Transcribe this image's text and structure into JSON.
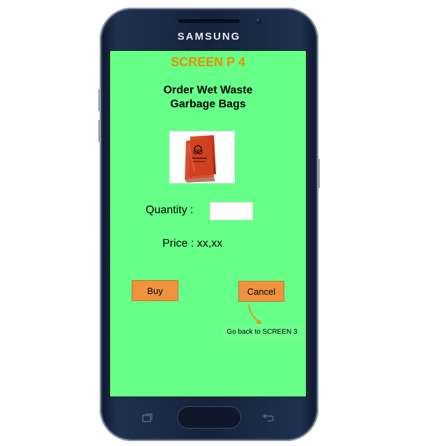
{
  "device": {
    "brand": "SAMSUNG"
  },
  "screen": {
    "title": "SCREEN P 4",
    "heading_line1": "Order Wet Waste",
    "heading_line2": "Garbage Bags",
    "product_image": "red-biohazard-garbage-bag",
    "quantity": {
      "label": "Quantity :",
      "value": ""
    },
    "price": {
      "label": "Price : xx,xx"
    },
    "buttons": {
      "buy_label": "Buy",
      "cancel_label": "Cancel"
    },
    "annotation": {
      "text": "Go back to SCREEN 3"
    }
  },
  "colors": {
    "screen_background": "#66ff88",
    "title_orange": "#f08c00",
    "button_orange": "#f0933e",
    "phone_body": "#15223a"
  },
  "icons": {
    "nav_recent": "recent-apps-icon",
    "nav_back": "back-icon"
  }
}
